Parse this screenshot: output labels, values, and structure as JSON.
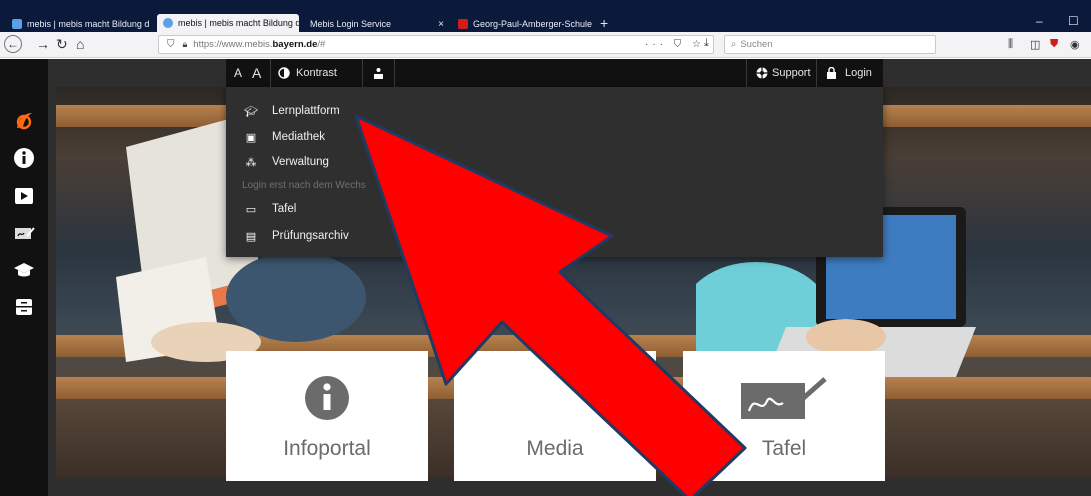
{
  "browser": {
    "tabs": [
      {
        "label": "mebis | mebis macht Bildung d",
        "active": false
      },
      {
        "label": "mebis | mebis macht Bildung d",
        "active": true
      },
      {
        "label": "Mebis Login Service",
        "active": false
      },
      {
        "label": "Georg-Paul-Amberger-Schule",
        "active": false
      }
    ],
    "tab_close": "×",
    "new_tab": "+",
    "url_prefix": "https://www.mebis.",
    "url_domain": "bayern.de",
    "url_suffix": "/#",
    "url_actions": "··· ⛉ ☆",
    "search_placeholder": "Suchen",
    "window_min": "–",
    "window_max": "☐"
  },
  "topbar": {
    "font_small": "A",
    "font_large": "A",
    "contrast": "Kontrast",
    "support": "Support",
    "login": "Login"
  },
  "dropdown": {
    "items": [
      {
        "label": "Lernplattform"
      },
      {
        "label": "Mediathek"
      },
      {
        "label": "Verwaltung"
      },
      {
        "label": "Tafel"
      },
      {
        "label": "Prüfungsarchiv"
      }
    ],
    "note": "Login erst nach dem Wechs"
  },
  "cards": [
    {
      "title": "Infoportal"
    },
    {
      "title": "Media"
    },
    {
      "title": "Tafel"
    }
  ],
  "colors": {
    "arrow_fill": "#ff0000",
    "arrow_stroke": "#1f3a63",
    "tab_strip": "#0b1a3a",
    "mebis_orange": "#ff6a13"
  }
}
